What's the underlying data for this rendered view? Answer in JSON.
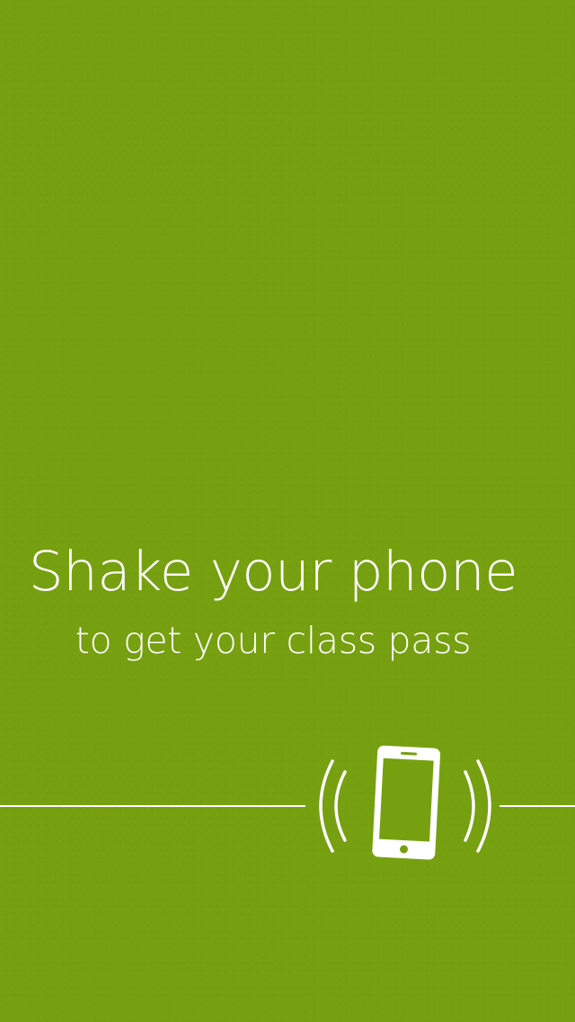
{
  "onboarding": {
    "headline": "Shake your phone",
    "subline": "to get your class pass"
  },
  "icons": {
    "shake": "vibrating-phone-icon"
  },
  "colors": {
    "background": "#76a00f",
    "foreground": "#ffffff"
  }
}
